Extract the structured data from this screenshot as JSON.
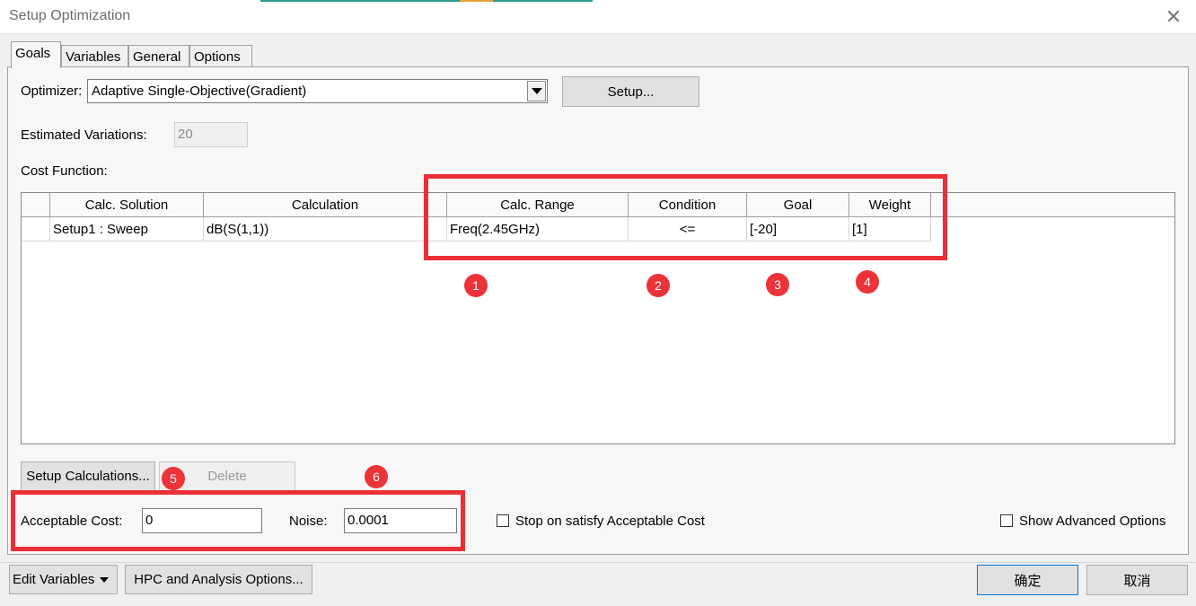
{
  "window": {
    "title": "Setup Optimization",
    "accent_color": "#2a9d8f"
  },
  "tabs": [
    {
      "label": "Goals",
      "active": true
    },
    {
      "label": "Variables"
    },
    {
      "label": "General"
    },
    {
      "label": "Options"
    }
  ],
  "optimizer": {
    "label": "Optimizer:",
    "selected": "Adaptive Single-Objective(Gradient)",
    "setup_button": "Setup..."
  },
  "estimated_variations": {
    "label": "Estimated Variations:",
    "value": "20"
  },
  "cost_function": {
    "label": "Cost Function:",
    "columns": [
      "Calc. Solution",
      "Calculation",
      "Calc. Range",
      "Condition",
      "Goal",
      "Weight"
    ],
    "rows": [
      {
        "solution": "Setup1 : Sweep",
        "calculation": "dB(S(1,1))",
        "range": "Freq(2.45GHz)",
        "condition": "<=",
        "goal": "[-20]",
        "weight": "[1]"
      }
    ]
  },
  "buttons": {
    "setup_calculations": "Setup Calculations...",
    "delete": "Delete",
    "edit_variables": "Edit Variables",
    "hpc": "HPC and Analysis Options...",
    "ok": "确定",
    "cancel": "取消"
  },
  "acceptable_cost": {
    "label": "Acceptable Cost:",
    "value": "0"
  },
  "noise": {
    "label": "Noise:",
    "value": "0.0001"
  },
  "stop_on_satisfy": {
    "label": "Stop on satisfy Acceptable Cost",
    "checked": false
  },
  "show_advanced": {
    "label": "Show Advanced Options",
    "checked": false
  },
  "annotations": [
    "1",
    "2",
    "3",
    "4",
    "5",
    "6"
  ],
  "colors": {
    "highlight_red": "#ec2e36",
    "focus_blue": "#0078d7"
  }
}
